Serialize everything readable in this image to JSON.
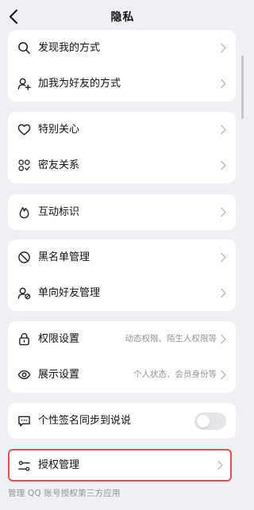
{
  "header": {
    "title": "隐私"
  },
  "sections": {
    "discover": [
      {
        "label": "发现我的方式",
        "icon": "search-icon"
      },
      {
        "label": "加我为好友的方式",
        "icon": "add-person-icon"
      }
    ],
    "care": [
      {
        "label": "特别关心",
        "icon": "heart-icon"
      },
      {
        "label": "密友关系",
        "icon": "friends-icon"
      }
    ],
    "interact": [
      {
        "label": "互动标识",
        "icon": "flame-icon"
      }
    ],
    "block": [
      {
        "label": "黑名单管理",
        "icon": "block-icon"
      },
      {
        "label": "单向好友管理",
        "icon": "one-way-friend-icon"
      }
    ],
    "perm": [
      {
        "label": "权限设置",
        "hint": "动态权限、陌生人权限等",
        "icon": "lock-icon"
      },
      {
        "label": "展示设置",
        "hint": "个人状态、会员身份等",
        "icon": "eye-icon"
      }
    ],
    "signature": {
      "label": "个性签名同步到说说",
      "icon": "message-icon",
      "enabled": false
    },
    "auth": {
      "label": "授权管理",
      "icon": "settings-sliders-icon"
    }
  },
  "footnote": "管理 QQ 账号授权第三方应用",
  "colors": {
    "highlight": "#e2524f",
    "background": "#eef0f3"
  }
}
